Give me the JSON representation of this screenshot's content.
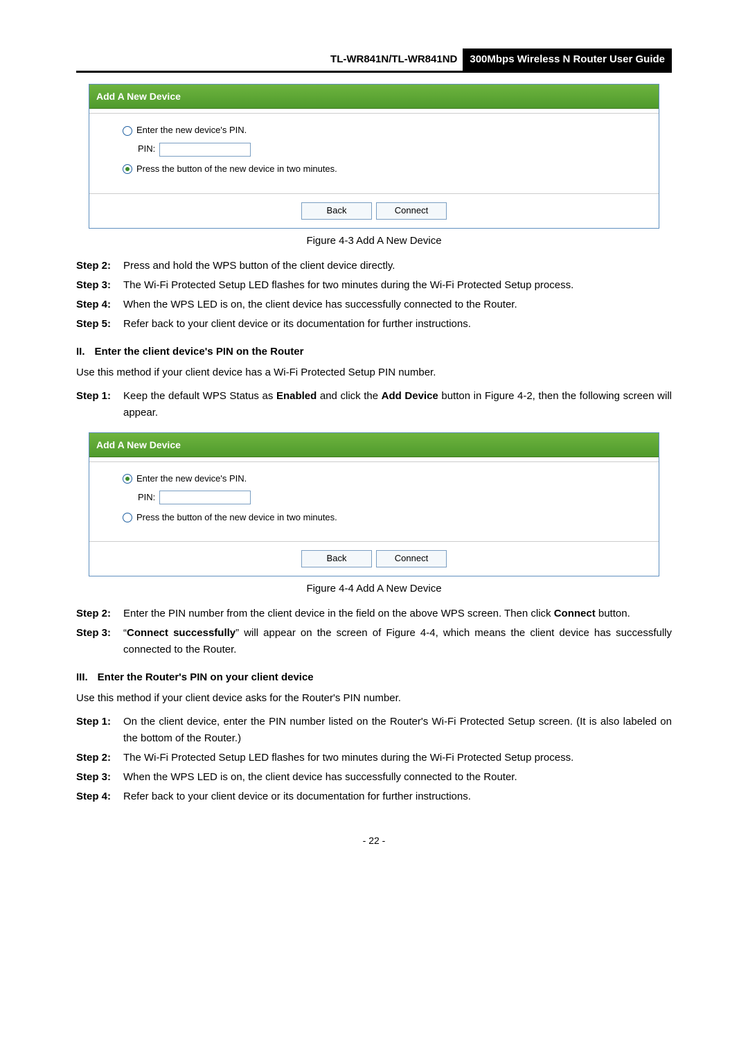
{
  "header": {
    "model": "TL-WR841N/TL-WR841ND",
    "guide": "300Mbps Wireless N Router User Guide"
  },
  "panel": {
    "title": "Add A New Device",
    "opt_pin": "Enter the new device's PIN.",
    "pin_label": "PIN:",
    "opt_button": "Press the button of the new device in two minutes.",
    "back": "Back",
    "connect": "Connect"
  },
  "fig43": "Figure 4-3 Add A New Device",
  "sA": {
    "s2l": "Step 2:",
    "s2": "Press and hold the WPS button of the client device directly.",
    "s3l": "Step 3:",
    "s3": "The Wi-Fi Protected Setup LED flashes for two minutes during the Wi-Fi Protected Setup process.",
    "s4l": "Step 4:",
    "s4": "When the WPS LED is on, the client device has successfully connected to the Router.",
    "s5l": "Step 5:",
    "s5": "Refer back to your client device or its documentation for further instructions."
  },
  "sec2": {
    "num": "II.",
    "title": "Enter the client device's PIN on the Router",
    "intro": "Use this method if your client device has a Wi-Fi Protected Setup PIN number."
  },
  "sB": {
    "s1l": "Step 1:",
    "s1a": "Keep the default WPS Status as ",
    "s1b": "Enabled",
    "s1c": " and click the ",
    "s1d": "Add Device",
    "s1e": " button in Figure 4-2, then the following screen will appear."
  },
  "fig44": "Figure 4-4   Add A New Device",
  "sC": {
    "s2l": "Step 2:",
    "s2a": "Enter the PIN number from the client device in the field on the above WPS screen. Then click ",
    "s2b": "Connect",
    "s2c": " button.",
    "s3l": "Step 3:",
    "s3a": "“",
    "s3b": "Connect successfully",
    "s3c": "” will appear on the screen of Figure 4-4, which means the client device has successfully connected to the Router."
  },
  "sec3": {
    "num": "III.",
    "title": "Enter the Router's PIN on your client device",
    "intro": "Use this method if your client device asks for the Router's PIN number."
  },
  "sD": {
    "s1l": "Step 1:",
    "s1": "On the client device, enter the PIN number listed on the Router's Wi-Fi Protected Setup screen. (It is also labeled on the bottom of the Router.)",
    "s2l": "Step 2:",
    "s2": "The Wi-Fi Protected Setup LED flashes for two minutes during the Wi-Fi Protected Setup process.",
    "s3l": "Step 3:",
    "s3": "When the WPS LED is on, the client device has successfully connected to the Router.",
    "s4l": "Step 4:",
    "s4": "Refer back to your client device or its documentation for further instructions."
  },
  "page": "- 22 -"
}
